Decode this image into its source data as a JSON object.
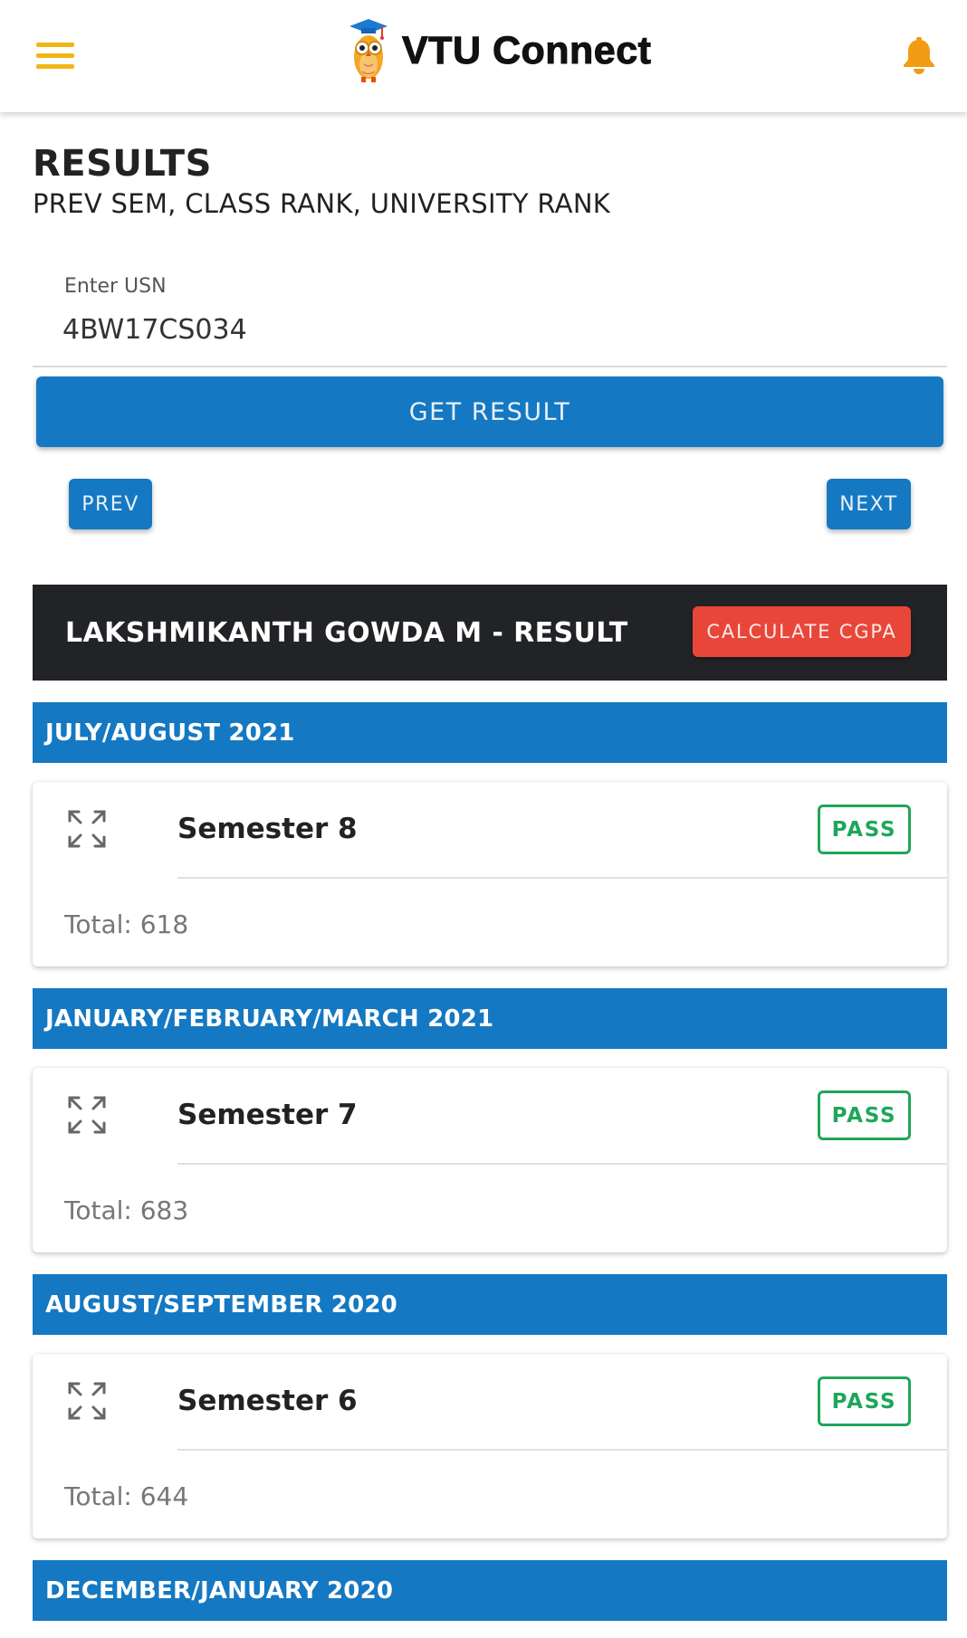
{
  "app": {
    "title": "VTU Connect"
  },
  "header": {
    "title": "RESULTS",
    "subtitle": "PREV SEM, CLASS RANK, UNIVERSITY RANK"
  },
  "usn": {
    "label": "Enter USN",
    "value": "4BW17CS034"
  },
  "buttons": {
    "get_result": "GET RESULT",
    "prev": "PREV",
    "next": "NEXT",
    "calculate_cgpa": "CALCULATE CGPA"
  },
  "result": {
    "name": "LAKSHMIKANTH GOWDA M - RESULT",
    "sessions": [
      {
        "label": "JULY/AUGUST 2021",
        "semester": "Semester 8",
        "status": "PASS",
        "total": "Total: 618"
      },
      {
        "label": "JANUARY/FEBRUARY/MARCH 2021",
        "semester": "Semester 7",
        "status": "PASS",
        "total": "Total: 683"
      },
      {
        "label": "AUGUST/SEPTEMBER 2020",
        "semester": "Semester 6",
        "status": "PASS",
        "total": "Total: 644"
      },
      {
        "label": "DECEMBER/JANUARY 2020"
      }
    ]
  },
  "colors": {
    "primary": "#1578c2",
    "accent": "#f2b518",
    "danger": "#e9463a",
    "success": "#1ea65a",
    "dark": "#222326"
  },
  "icons": {
    "menu": "hamburger-menu-icon",
    "logo": "owl-graduate-icon",
    "notification": "bell-icon",
    "expand": "expand-arrows-icon"
  }
}
